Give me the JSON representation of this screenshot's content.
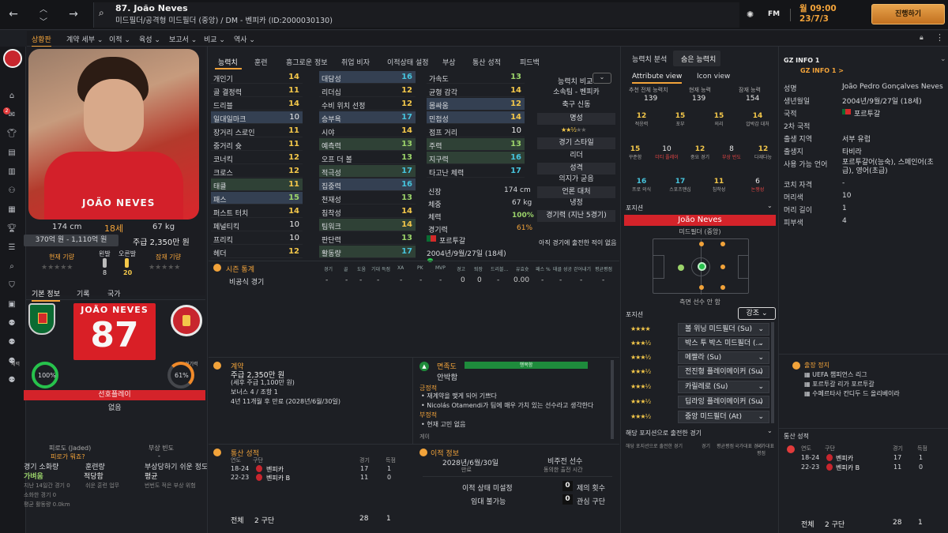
{
  "player": {
    "title": "87. João Neves",
    "subtitle": "미드필더/공격형 미드필더 (중앙) / DM - 벤피카 (ID:2000030130)",
    "name_jersey": "JOÃO NEVES",
    "number": "87",
    "height": "174 cm",
    "age": "18세",
    "weight": "67 kg",
    "value": "370억 원 - 1,110억 원",
    "wage": "주급 2,350만 원",
    "current_ability_label": "현재 기량",
    "potential_label": "잠재 기량",
    "foot_left_label": "왼발",
    "foot_right_label": "오른발",
    "foot_left": "8",
    "foot_right": "20"
  },
  "topbar": {
    "date_line1": "월 09:00",
    "date_line2": "23/7/3",
    "continue": "진행하기",
    "fm": "FM"
  },
  "menus": [
    "상황판",
    "계약 세부",
    "이적",
    "육성",
    "보고서",
    "비교",
    "역사"
  ],
  "sidebar_icons": [
    "benfica-badge-icon",
    "home-icon",
    "inbox-icon",
    "squad-icon",
    "tactics-icon",
    "dynamics-icon",
    "staff-icon",
    "schedule-icon",
    "competition-icon",
    "data-icon",
    "scouting-icon",
    "search-icon",
    "club-icon",
    "finance-icon",
    "people-icon",
    "training-icon",
    "medical-icon",
    "development-icon"
  ],
  "inbox_badge": "2",
  "tabs_main": [
    "능력치",
    "훈련",
    "흥그로운 정보",
    "취업 비자",
    "이적상태 설정",
    "부상",
    "통산 성적",
    "피드백"
  ],
  "attrs_col1": [
    {
      "n": "개인기",
      "v": "14"
    },
    {
      "n": "골 결정력",
      "v": "11"
    },
    {
      "n": "드리블",
      "v": "14"
    },
    {
      "n": "일대일마크",
      "v": "10",
      "hl": 1
    },
    {
      "n": "장거리 스로인",
      "v": "11"
    },
    {
      "n": "중거리 슛",
      "v": "11"
    },
    {
      "n": "코너킥",
      "v": "12"
    },
    {
      "n": "크로스",
      "v": "12"
    },
    {
      "n": "태클",
      "v": "11",
      "hg": 1
    },
    {
      "n": "패스",
      "v": "15",
      "hl": 1
    },
    {
      "n": "퍼스트 터치",
      "v": "14"
    },
    {
      "n": "페널티킥",
      "v": "10"
    },
    {
      "n": "프리킥",
      "v": "10"
    },
    {
      "n": "헤더",
      "v": "12"
    }
  ],
  "attrs_col2": [
    {
      "n": "대담성",
      "v": "16",
      "hl": 1
    },
    {
      "n": "리더십",
      "v": "12"
    },
    {
      "n": "수비 위치 선정",
      "v": "12"
    },
    {
      "n": "승부욕",
      "v": "17",
      "hl": 1
    },
    {
      "n": "시야",
      "v": "14"
    },
    {
      "n": "예측력",
      "v": "13",
      "hg": 1
    },
    {
      "n": "오프 더 볼",
      "v": "13"
    },
    {
      "n": "적극성",
      "v": "17",
      "hg": 1
    },
    {
      "n": "집중력",
      "v": "16",
      "hl": 1
    },
    {
      "n": "천재성",
      "v": "13"
    },
    {
      "n": "침착성",
      "v": "14"
    },
    {
      "n": "팀워크",
      "v": "14",
      "hg": 1
    },
    {
      "n": "판단력",
      "v": "13"
    },
    {
      "n": "활동량",
      "v": "17",
      "hg": 1
    }
  ],
  "attrs_col3": [
    {
      "n": "가속도",
      "v": "13"
    },
    {
      "n": "균형 감각",
      "v": "14"
    },
    {
      "n": "몸싸움",
      "v": "12",
      "hl": 1
    },
    {
      "n": "민첩성",
      "v": "14",
      "hl": 1
    },
    {
      "n": "점프 거리",
      "v": "10"
    },
    {
      "n": "주력",
      "v": "13",
      "hg": 1
    },
    {
      "n": "지구력",
      "v": "16",
      "hg": 1
    },
    {
      "n": "타고난 체력",
      "v": "17"
    }
  ],
  "bio": {
    "height_l": "신장",
    "height_v": "174 cm",
    "weight_l": "체중",
    "weight_v": "67 kg",
    "stamina_l": "체력",
    "stamina_v": "100%",
    "sharp_l": "경기력",
    "sharp_v": "61%",
    "nation": "포르투갈",
    "dob": "2004년/9월/27일 (18세)"
  },
  "side_info": {
    "compare": "능력치 비교",
    "club": "소속팀 - 벤피카",
    "role": "축구 신동",
    "rep_label": "명성",
    "style_label": "경기 스타일",
    "style_val": "리더",
    "pers_label": "성격",
    "pers_val": "의지가 굳음",
    "media_label": "언론 대처",
    "media_val": "냉정",
    "form_label": "경기력 (지난 5경기)",
    "form_note": "아직 경기에 출전한 적이 없음"
  },
  "season": {
    "title": "시즌 통계",
    "cols": [
      "경기",
      "골",
      "도움",
      "기대 득점",
      "XA",
      "PK",
      "MVP",
      "경고",
      "퇴장",
      "드리블...",
      "유효슛",
      "패스 %",
      "태클 성공",
      "걷어내기",
      "평균평점"
    ],
    "row_label": "비공식 경기",
    "vals": [
      "-",
      "-",
      "-",
      "-",
      "-",
      "-",
      "-",
      "0",
      "0",
      "-",
      "0.00",
      "-",
      "-",
      "-",
      "-"
    ]
  },
  "ability": {
    "tab1": "능력치 분석",
    "tab2": "숨은 능력치",
    "sub1": "Attribute view",
    "sub2": "Icon view",
    "ca_l": "추천 전체 능력치",
    "ca": "139",
    "cur_l": "현재 능력",
    "cur": "139",
    "pot_l": "잠재 능력",
    "pot": "154"
  },
  "hidden": [
    {
      "n": "12",
      "l": "적응력"
    },
    {
      "n": "15",
      "l": "포부"
    },
    {
      "n": "15",
      "l": "의리"
    },
    {
      "n": "14",
      "l": "압박감 대처"
    },
    {
      "n": "15",
      "l": "꾸준함"
    },
    {
      "n": "10",
      "l": "더티 플레이",
      "r": 1
    },
    {
      "n": "12",
      "l": "중요 경기"
    },
    {
      "n": "8",
      "l": "부상 빈도",
      "r": 1
    },
    {
      "n": "12",
      "l": "다재다능"
    },
    {
      "n": "16",
      "l": "프로 의식"
    },
    {
      "n": "17",
      "l": "스포츠맨십"
    },
    {
      "n": "11",
      "l": "침착성"
    },
    {
      "n": "6",
      "l": "논쟁성",
      "r": 1
    }
  ],
  "position": {
    "title": "포지션",
    "name": "João Neves",
    "pos": "미드필더 (중앙)",
    "foot": "측면 선수 안 함",
    "roles_title": "포지션",
    "emphasis": "강조"
  },
  "roles": [
    {
      "s": "★★★★",
      "n": "볼 위닝 미드필더 (Su)"
    },
    {
      "s": "★★★½",
      "n": "박스 투 박스 미드필더 (..."
    },
    {
      "s": "★★★½",
      "n": "메짤라 (Su)"
    },
    {
      "s": "★★★½",
      "n": "전진형 플레이메이커 (Su)"
    },
    {
      "s": "★★★½",
      "n": "카릴레로 (Su)"
    },
    {
      "s": "★★★½",
      "n": "딥라잉 플레이메이커 (Su)"
    },
    {
      "s": "★★★½",
      "n": "중앙 미드필더 (At)"
    }
  ],
  "pos_matches": {
    "title": "해당 포지션으로 출전한 경기",
    "cols": [
      "해당 포지션으로 출전한 경기",
      "경기",
      "평균평점",
      "국가대표 경기",
      "국가대표 평점"
    ]
  },
  "gz": {
    "title": "GZ INFO 1",
    "link": "GZ INFO 1 >",
    "rows": [
      {
        "l": "성명",
        "v": "João Pedro Gonçalves Neves"
      },
      {
        "l": "생년월일",
        "v": "2004년/9월/27일 (18세)"
      },
      {
        "l": "국적",
        "v": "포르투갈"
      },
      {
        "l": "2차 국적",
        "v": ""
      },
      {
        "l": "출생 지역",
        "v": "서부 유럽"
      },
      {
        "l": "출생지",
        "v": "타비라"
      },
      {
        "l": "사용 가능 언어",
        "v": "포르투갈어(능숙), 스페인어(초급), 영어(초급)"
      },
      {
        "l": "코치 자격",
        "v": "-"
      },
      {
        "l": "머리색",
        "v": "10"
      },
      {
        "l": "머리 길이",
        "v": "1"
      },
      {
        "l": "피부색",
        "v": "4"
      }
    ]
  },
  "bottom_left": {
    "tab1": "기본 정보",
    "tab2": "기록",
    "tab3": "국가",
    "sel": "선호플레이",
    "sel_val": "없음",
    "stamina": "100%",
    "sharp": "61%",
    "stamina_l": "체력",
    "sharp_l": "경기력",
    "jaded_l": "피로도 (Jaded)",
    "jaded_v": "피로가 뭐죠?",
    "inj_l": "부상 빈도",
    "inj_v": "-",
    "c1l": "경기 소화량",
    "c1v": "가벼움",
    "c2l": "훈련량",
    "c2v": "적당함",
    "c3l": "부상당하기 쉬운 정도",
    "c3v": "평균",
    "d1": "지난 14일간 경기 0",
    "d2": "쉬운 훈련 업무",
    "d3": "번번도 적은 부상 위험",
    "d4": "소화한 경기 0",
    "d5": "평균 활동량 0.0km"
  },
  "contract": {
    "title": "계약",
    "wage": "주급 2,350만 원",
    "sub": "(세후 주급 1,100만 원)",
    "bonus": "보너스 4 / 조항 1",
    "expiry": "4년 11개월 후 만료 (2028년/6월/30일)"
  },
  "mood": {
    "title": "면족도",
    "bar": "행복함",
    "person": "안박함",
    "pos_title": "긍정적",
    "pos1": "재계약을 맺게 되어 기쁘다",
    "pos2": "Nicolás Otamendi가 팀에 매우 가치 있는 선수라고 생각한다",
    "neg_title": "부정적",
    "neg1": "현재 고민 없음",
    "more": "게이"
  },
  "career_mid": {
    "title": "통산 성적",
    "cols": [
      "연도",
      "구단",
      "경기",
      "득점"
    ],
    "rows": [
      {
        "y": "18-24",
        "t": "벤피카",
        "a": "17",
        "g": "1"
      },
      {
        "y": "22-23",
        "t": "벤피카 B",
        "a": "11",
        "g": "0"
      }
    ],
    "total_l": "전체",
    "total_t": "2 구단",
    "total_a": "28",
    "total_g": "1"
  },
  "transfer": {
    "title": "이적 정보",
    "date": "2028년/6월/30일",
    "date_l": "만료",
    "status": "비주전 선수",
    "status_sub": "동의한 출전 시간",
    "avail": "이적 상태 미설정",
    "loan": "임대 불가능",
    "offers_n": "0",
    "offers_l": "제의 횟수",
    "int_n": "0",
    "int_l": "관심 구단"
  },
  "banned": {
    "title": "출장 정지",
    "items": [
      "UEFA 챔피언스 리그",
      "포르투갈 리가 포르투갈",
      "수페르타사 칸디두 드 올리베이라"
    ]
  },
  "career_right": {
    "title": "통산 성적",
    "cols": [
      "연도",
      "구단",
      "경기",
      "득점"
    ],
    "rows": [
      {
        "y": "18-24",
        "t": "벤피카",
        "a": "17",
        "g": "1"
      },
      {
        "y": "22-23",
        "t": "벤피카 B",
        "a": "11",
        "g": "0"
      }
    ],
    "total_l": "전체",
    "total_t": "2 구단",
    "total_a": "28",
    "total_g": "1"
  },
  "colors": {
    "accent": "#f2a33a",
    "benfica": "#e8202a",
    "attr_yellow": "#f3c74a",
    "attr_green": "#9bd36a",
    "attr_cyan": "#46c3dc"
  }
}
